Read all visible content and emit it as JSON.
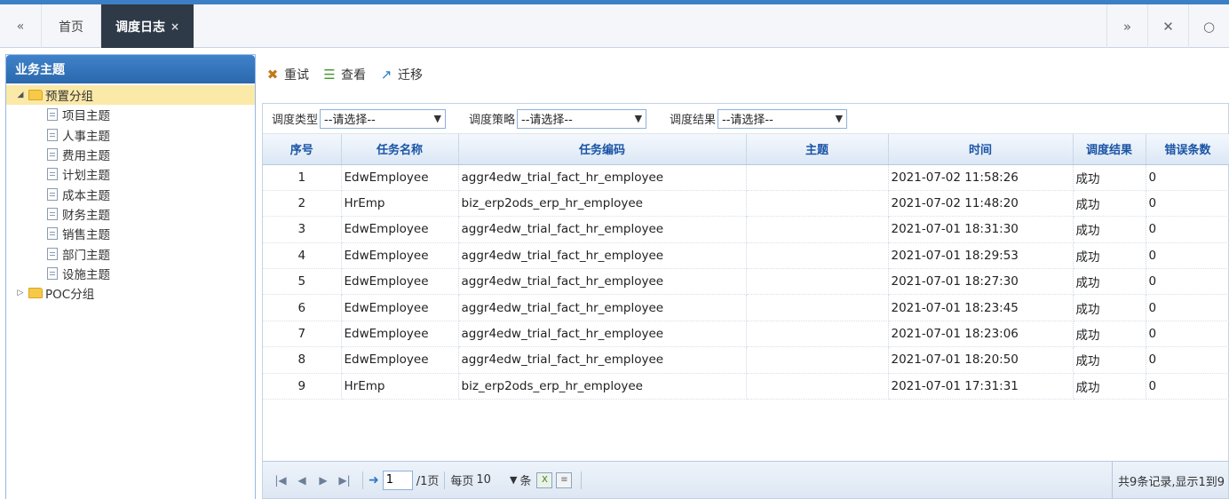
{
  "tabs": {
    "prev_icon": "«",
    "home_label": "首页",
    "active_label": "调度日志",
    "active_close": "×",
    "right_icons": {
      "next": "»",
      "close_all": "✕",
      "settings": "○"
    }
  },
  "sidebar": {
    "title": "业务主题",
    "groups": [
      {
        "label": "预置分组",
        "expanded": true,
        "items": [
          "项目主题",
          "人事主题",
          "费用主题",
          "计划主题",
          "成本主题",
          "财务主题",
          "销售主题",
          "部门主题",
          "设施主题"
        ]
      },
      {
        "label": "POC分组",
        "expanded": false,
        "items": []
      }
    ]
  },
  "toolbar": {
    "retry_label": "重试",
    "view_label": "查看",
    "migrate_label": "迁移"
  },
  "filters": [
    {
      "label": "调度类型",
      "value": "--请选择--"
    },
    {
      "label": "调度策略",
      "value": "--请选择--"
    },
    {
      "label": "调度结果",
      "value": "--请选择--"
    }
  ],
  "table": {
    "columns": [
      "序号",
      "任务名称",
      "任务编码",
      "主题",
      "时间",
      "调度结果",
      "错误条数"
    ],
    "rows": [
      [
        "1",
        "EdwEmployee",
        "aggr4edw_trial_fact_hr_employee",
        "",
        "2021-07-02 11:58:26",
        "成功",
        "0"
      ],
      [
        "2",
        "HrEmp",
        "biz_erp2ods_erp_hr_employee",
        "",
        "2021-07-02 11:48:20",
        "成功",
        "0"
      ],
      [
        "3",
        "EdwEmployee",
        "aggr4edw_trial_fact_hr_employee",
        "",
        "2021-07-01 18:31:30",
        "成功",
        "0"
      ],
      [
        "4",
        "EdwEmployee",
        "aggr4edw_trial_fact_hr_employee",
        "",
        "2021-07-01 18:29:53",
        "成功",
        "0"
      ],
      [
        "5",
        "EdwEmployee",
        "aggr4edw_trial_fact_hr_employee",
        "",
        "2021-07-01 18:27:30",
        "成功",
        "0"
      ],
      [
        "6",
        "EdwEmployee",
        "aggr4edw_trial_fact_hr_employee",
        "",
        "2021-07-01 18:23:45",
        "成功",
        "0"
      ],
      [
        "7",
        "EdwEmployee",
        "aggr4edw_trial_fact_hr_employee",
        "",
        "2021-07-01 18:23:06",
        "成功",
        "0"
      ],
      [
        "8",
        "EdwEmployee",
        "aggr4edw_trial_fact_hr_employee",
        "",
        "2021-07-01 18:20:50",
        "成功",
        "0"
      ],
      [
        "9",
        "HrEmp",
        "biz_erp2ods_erp_hr_employee",
        "",
        "2021-07-01 17:31:31",
        "成功",
        "0"
      ]
    ]
  },
  "pager": {
    "page_value": "1",
    "total_pages_label": "/1页",
    "per_page_label": "每页",
    "page_size": "10",
    "unit_label": "条",
    "summary": "共9条记录,显示1到9"
  },
  "colors": {
    "accent": "#3d7fc7",
    "active_tab": "#2f3a48",
    "header_text": "#1a54a6",
    "selected_node": "#fbe9a8"
  }
}
